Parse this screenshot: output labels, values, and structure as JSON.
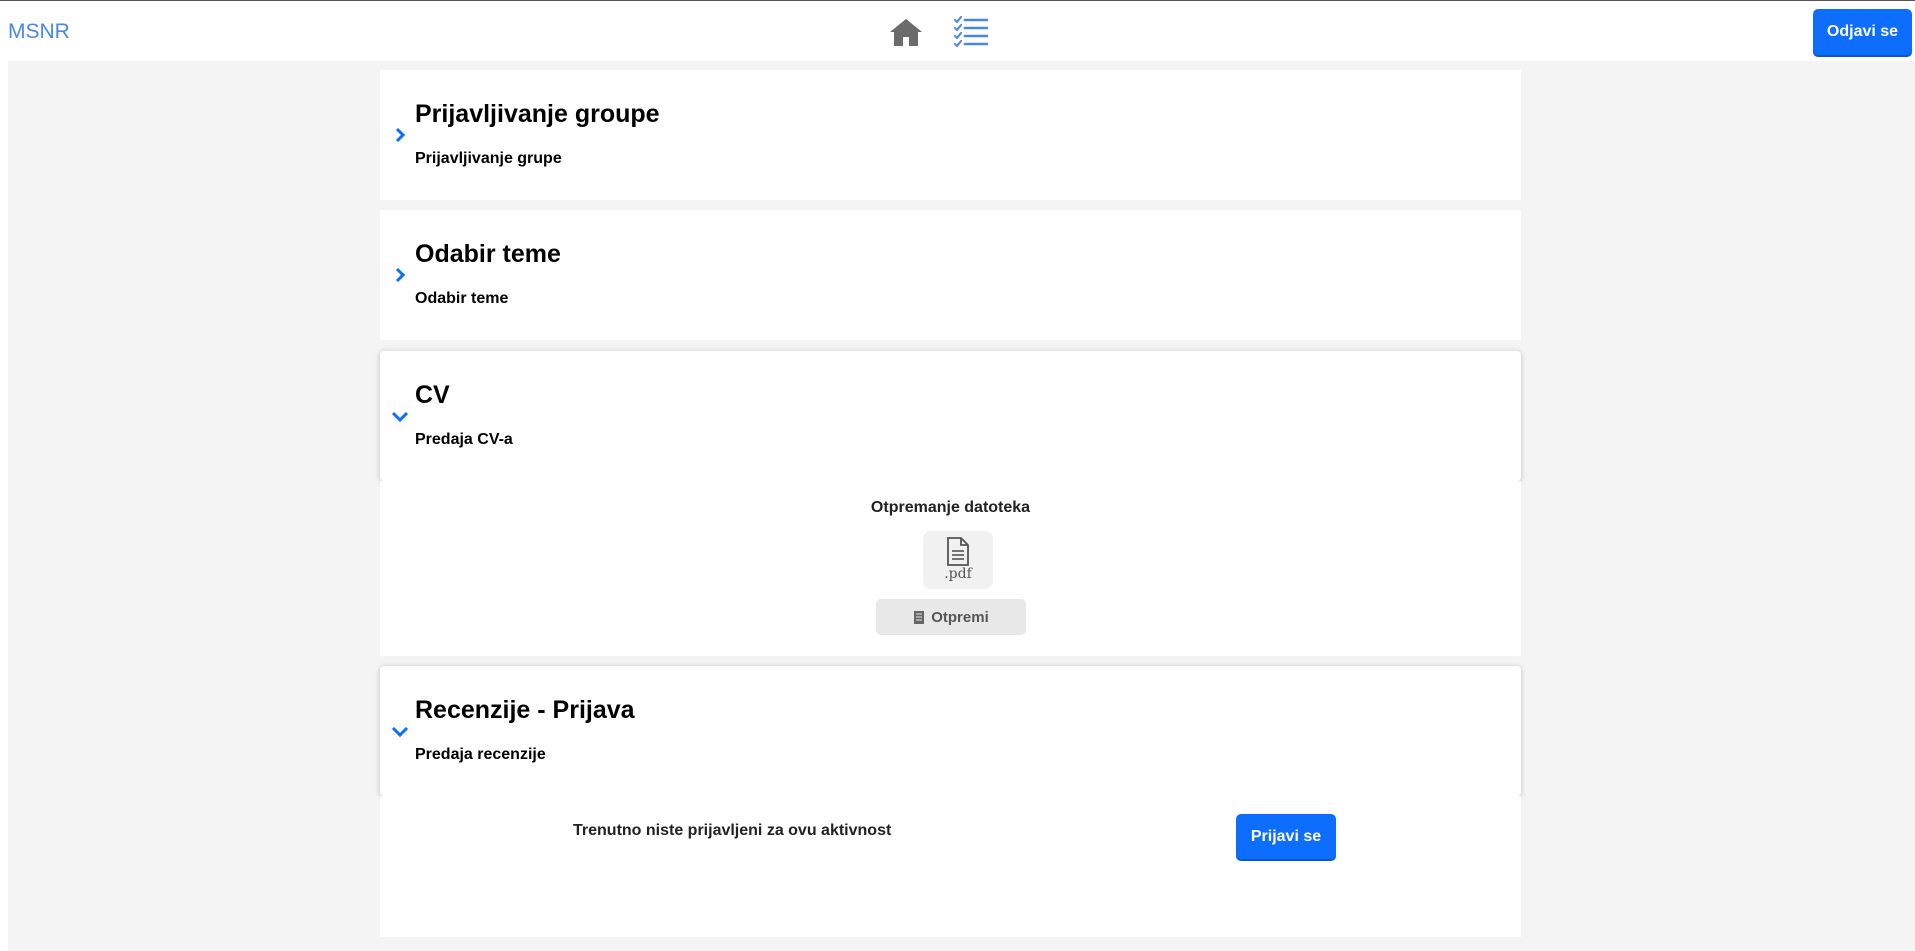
{
  "header": {
    "brand": "MSNR",
    "home_icon": "home-icon",
    "list_icon": "checklist-icon",
    "logout_label": "Odjavi se"
  },
  "colors": {
    "primary": "#0d6efd",
    "brand_text": "#4a86e8",
    "icon_gray": "#6b6b6b",
    "background": "#f4f4f4"
  },
  "activities": [
    {
      "title": "Prijavljivanje groupe",
      "subtitle": "Prijavljivanje grupe",
      "state": "collapsed",
      "icon": "chevron-right-icon"
    },
    {
      "title": "Odabir teme",
      "subtitle": "Odabir teme",
      "state": "collapsed",
      "icon": "chevron-right-icon"
    },
    {
      "title": "CV",
      "subtitle": "Predaja CV-a",
      "state": "expanded",
      "icon": "chevron-down-icon"
    },
    {
      "title": "Recenzije - Prijava",
      "subtitle": "Predaja recenzije",
      "state": "expanded",
      "icon": "chevron-down-icon"
    }
  ],
  "cv_panel": {
    "upload_title": "Otpremanje datoteka",
    "file_icon": "file-icon",
    "file_ext": ".pdf",
    "upload_button": "Otpremi",
    "upload_button_icon": "document-icon"
  },
  "review_panel": {
    "status_text": "Trenutno niste prijavljeni za ovu aktivnost",
    "signup_button": "Prijavi se"
  }
}
